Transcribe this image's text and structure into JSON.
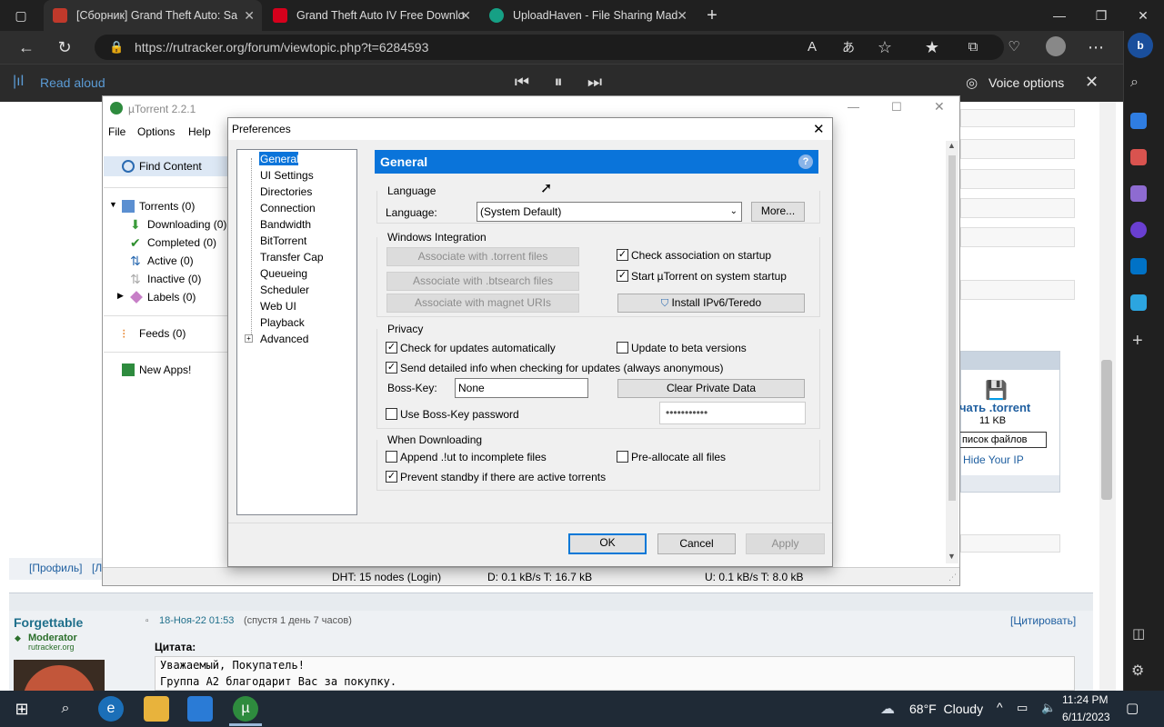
{
  "browser": {
    "tabs": [
      {
        "title": "[Сборник] Grand Theft Auto: Sa"
      },
      {
        "title": "Grand Theft Auto IV Free Downlo"
      },
      {
        "title": "UploadHaven - File Sharing Mad"
      }
    ],
    "url": "https://rutracker.org/forum/viewtopic.php?t=6284593",
    "read_aloud": "Read aloud",
    "voice_options": "Voice options"
  },
  "utorrent": {
    "title": "µTorrent 2.2.1",
    "menu": [
      "File",
      "Options",
      "Help"
    ],
    "sidebar": {
      "find_content": "Find Content",
      "torrents": "Torrents (0)",
      "downloading": "Downloading (0)",
      "completed": "Completed (0)",
      "active": "Active (0)",
      "inactive": "Inactive (0)",
      "labels": "Labels (0)",
      "feeds": "Feeds (0)",
      "new_apps": "New Apps!"
    },
    "status": {
      "dht": "DHT: 15 nodes (Login)",
      "down": "D: 0.1 kB/s T: 16.7 kB",
      "up": "U: 0.1 kB/s T: 8.0 kB"
    }
  },
  "preferences": {
    "title": "Preferences",
    "tree": [
      "General",
      "UI Settings",
      "Directories",
      "Connection",
      "Bandwidth",
      "BitTorrent",
      "Transfer Cap",
      "Queueing",
      "Scheduler",
      "Web UI",
      "Playback",
      "Advanced"
    ],
    "header": "General",
    "language_group": "Language",
    "language_label": "Language:",
    "language_value": "(System Default)",
    "more_button": "More...",
    "windows_group": "Windows Integration",
    "assoc_torrent": "Associate with .torrent files",
    "assoc_btsearch": "Associate with .btsearch files",
    "assoc_magnet": "Associate with magnet URIs",
    "check_assoc": "Check association on startup",
    "start_utorrent": "Start µTorrent on system startup",
    "install_ipv6": "Install IPv6/Teredo",
    "privacy_group": "Privacy",
    "check_updates": "Check for updates automatically",
    "beta": "Update to beta versions",
    "send_info": "Send detailed info when checking for updates (always anonymous)",
    "boss_key_label": "Boss-Key:",
    "boss_key_value": "None",
    "clear_private": "Clear Private Data",
    "use_boss_pw": "Use Boss-Key password",
    "boss_pw_value": "•••••••••••",
    "downloading_group": "When Downloading",
    "append_lut": "Append .!ut to incomplete files",
    "prealloc": "Pre-allocate all files",
    "prevent_standby": "Prevent standby if there are active torrents",
    "ok": "OK",
    "cancel": "Cancel",
    "apply": "Apply",
    "checks": {
      "check_assoc": true,
      "start_utorrent": true,
      "check_updates": true,
      "beta": false,
      "send_info": true,
      "use_boss_pw": false,
      "append_lut": false,
      "prealloc": false,
      "prevent_standby": true
    }
  },
  "forum": {
    "profile_link": "[Профиль]",
    "bracket_l": "[Л",
    "torrent_link": "чать .torrent",
    "torrent_size": "11 KB",
    "file_list": "писок файлов",
    "hide_ip": "Hide Your IP",
    "username": "Forgettable",
    "role": "Moderator",
    "site": "rutracker.org",
    "post_date": "18-Ноя-22 01:53",
    "post_after": "(спустя 1 день 7 часов)",
    "quote_btn": "[Цитировать]",
    "quote_label": "Цитата:",
    "quote_line1": "Уважаемый, Покупатель!",
    "quote_line2": "Группа А2 благодарит Вас за покупку."
  },
  "taskbar": {
    "weather": "68°F  Cloudy",
    "time": "11:24 PM",
    "date": "6/11/2023"
  }
}
